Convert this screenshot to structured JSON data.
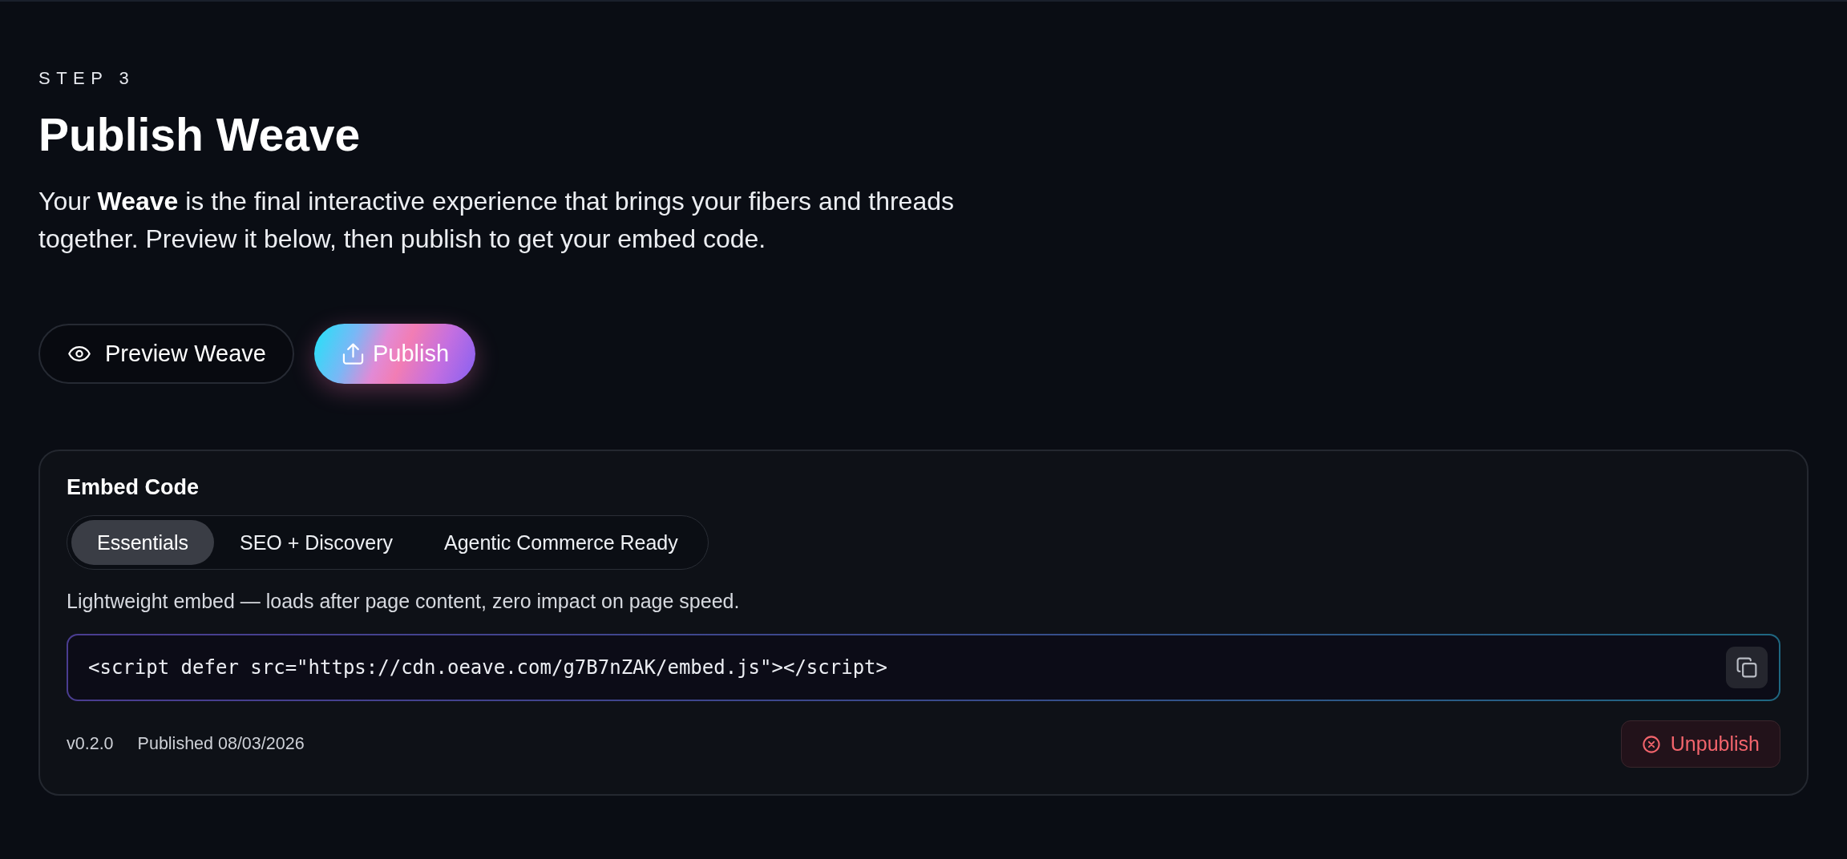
{
  "header": {
    "step": "STEP 3",
    "title": "Publish Weave",
    "intro": "Your **Weave** is the final interactive experience that brings your fibers and threads together. Preview it below, then publish to get your embed code."
  },
  "actions": [
    {
      "kind": "outline",
      "label": "Preview Weave"
    },
    {
      "kind": "gradient",
      "label": "Publish"
    }
  ],
  "embed": {
    "title": "Embed Code",
    "tabs": [
      {
        "label": "Essentials",
        "selected": true
      },
      {
        "label": "SEO + Discovery",
        "selected": false
      },
      {
        "label": "Agentic Commerce Ready",
        "selected": false
      }
    ],
    "description": "Lightweight embed — loads after page content, zero impact on page speed.",
    "code": "<script defer src=\"https://cdn.oeave.com/g7B7nZAK/embed.js\"></script>",
    "version": "v0.2.0",
    "published": "Published 08/03/2026",
    "unpublish": "Unpublish"
  }
}
